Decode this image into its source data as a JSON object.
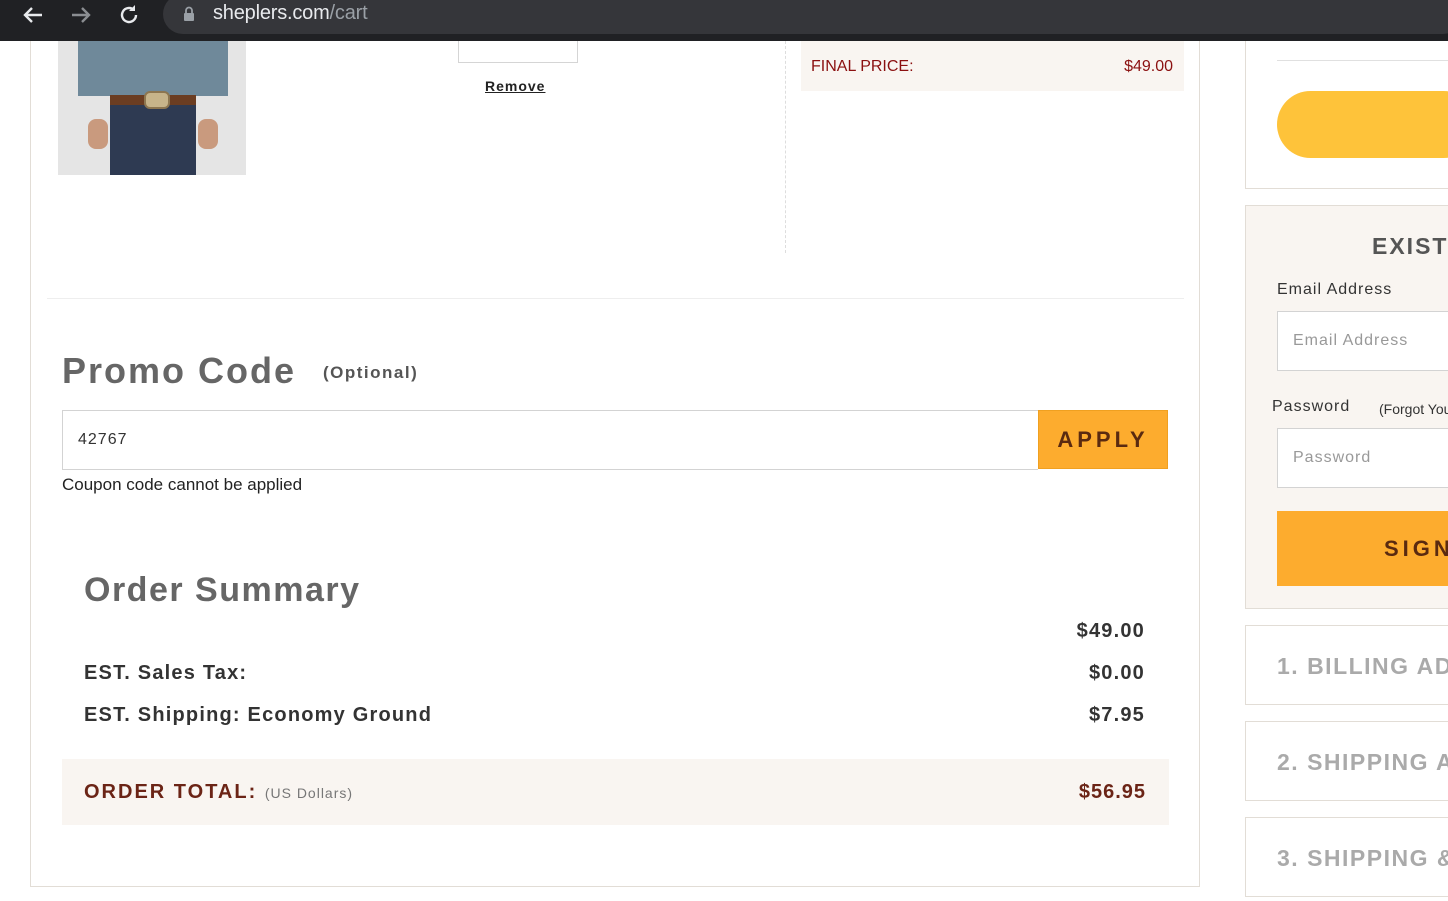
{
  "browser": {
    "url_host": "sheplers.com",
    "url_path": "/cart"
  },
  "cart_item": {
    "remove_label": "Remove",
    "final_price_label": "FINAL PRICE:",
    "final_price_value": "$49.00"
  },
  "promo": {
    "title": "Promo Code",
    "optional": "(Optional)",
    "value": "42767",
    "apply_label": "APPLY",
    "error": "Coupon code cannot be applied"
  },
  "summary": {
    "title": "Order Summary",
    "subtotal_value": "$49.00",
    "tax_label": "EST. Sales Tax:",
    "tax_value": "$0.00",
    "shipping_label": "EST. Shipping: Economy Ground",
    "shipping_value": "$7.95",
    "total_label": "ORDER TOTAL:",
    "total_note": "(US Dollars)",
    "total_value": "$56.95"
  },
  "login": {
    "title": "EXISTI",
    "email_label": "Email Address",
    "email_placeholder": "Email Address",
    "password_label": "Password",
    "forgot_label": "(Forgot You",
    "password_placeholder": "Password",
    "sign_in_label": "SIGN"
  },
  "steps": [
    {
      "label": "1. BILLING AD"
    },
    {
      "label": "2. SHIPPING A"
    },
    {
      "label": "3. SHIPPING &"
    }
  ]
}
